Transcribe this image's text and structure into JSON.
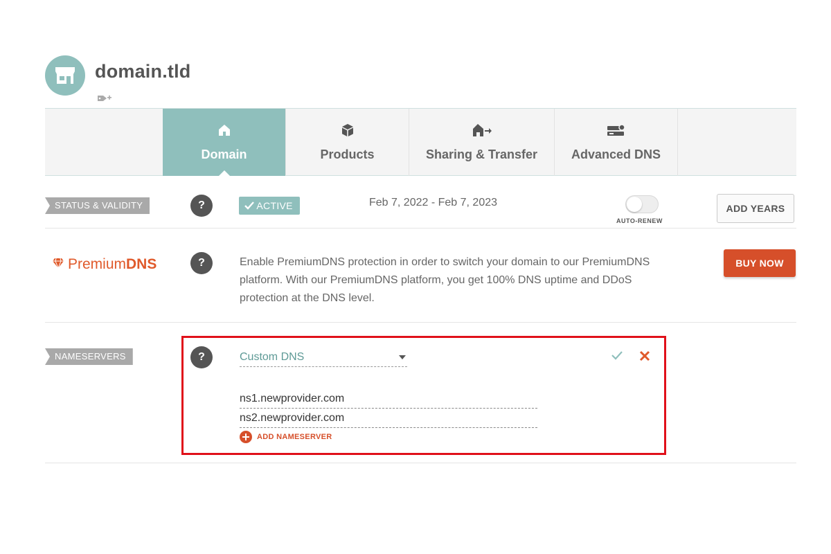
{
  "header": {
    "domain": "domain.tld",
    "avatar_icon": "store-icon",
    "tag_icon": "add-tag-icon"
  },
  "tabs": [
    {
      "label": "Domain",
      "icon": "home-icon",
      "active": true
    },
    {
      "label": "Products",
      "icon": "box-icon",
      "active": false
    },
    {
      "label": "Sharing & Transfer",
      "icon": "house-arrow-icon",
      "active": false
    },
    {
      "label": "Advanced DNS",
      "icon": "server-icon",
      "active": false
    }
  ],
  "status": {
    "label": "STATUS & VALIDITY",
    "help": "?",
    "badge": "ACTIVE",
    "dates": "Feb 7, 2022 - Feb 7, 2023",
    "auto_renew_label": "AUTO-RENEW",
    "auto_renew_on": false,
    "add_years_label": "ADD YEARS"
  },
  "premium": {
    "logo_regular": "Premium",
    "logo_bold": "DNS",
    "help": "?",
    "description": "Enable PremiumDNS protection in order to switch your domain to our PremiumDNS platform. With our PremiumDNS platform, you get 100% DNS uptime and DDoS protection at the DNS level.",
    "buy_label": "BUY NOW"
  },
  "nameservers": {
    "label": "NAMESERVERS",
    "help": "?",
    "selected": "Custom DNS",
    "entries": [
      "ns1.newprovider.com",
      "ns2.newprovider.com"
    ],
    "add_label": "ADD NAMESERVER"
  },
  "colors": {
    "teal": "#8fbfbc",
    "orange": "#d64f2a",
    "highlight": "#e0101a"
  }
}
